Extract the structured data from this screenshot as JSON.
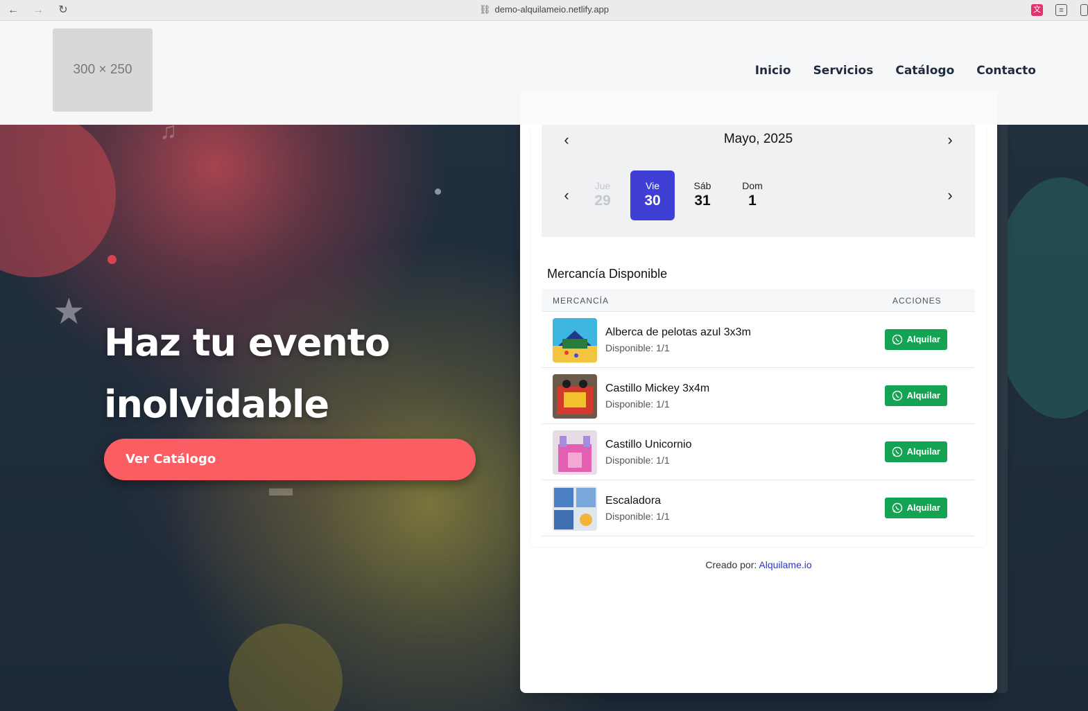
{
  "browser": {
    "url": "demo-alquilameio.netlify.app"
  },
  "header": {
    "logo_placeholder": "300 × 250",
    "nav": [
      "Inicio",
      "Servicios",
      "Catálogo",
      "Contacto"
    ]
  },
  "hero": {
    "title_line1": "Haz tu evento",
    "title_line2": "inolvidable",
    "cta_label": "Ver Catálogo"
  },
  "calendar": {
    "month_label": "Mayo, 2025",
    "days": [
      {
        "name": "Jue",
        "num": "29",
        "state": "muted"
      },
      {
        "name": "Vie",
        "num": "30",
        "state": "active"
      },
      {
        "name": "Sáb",
        "num": "31",
        "state": "normal"
      },
      {
        "name": "Dom",
        "num": "1",
        "state": "normal"
      }
    ]
  },
  "inventory": {
    "section_title": "Mercancía Disponible",
    "col_item": "MERCANCÍA",
    "col_actions": "ACCIONES",
    "rows": [
      {
        "name": "Alberca de pelotas azul 3x3m",
        "availability": "Disponible: 1/1",
        "action": "Alquilar"
      },
      {
        "name": "Castillo Mickey 3x4m",
        "availability": "Disponible: 1/1",
        "action": "Alquilar"
      },
      {
        "name": "Castillo Unicornio",
        "availability": "Disponible: 1/1",
        "action": "Alquilar"
      },
      {
        "name": "Escaladora",
        "availability": "Disponible: 1/1",
        "action": "Alquilar"
      }
    ]
  },
  "footer": {
    "created_by": "Creado por:",
    "brand": "Alquilame.io"
  },
  "colors": {
    "accent_active_day": "#3f3fd6",
    "cta": "#fb5e62",
    "whatsapp_button": "#13a352",
    "link": "#2d35c9"
  }
}
